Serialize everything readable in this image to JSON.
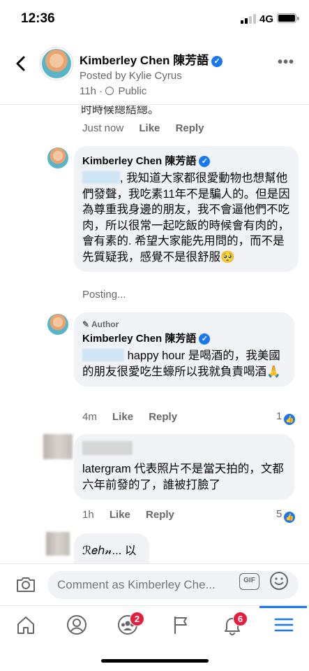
{
  "status_bar": {
    "time": "12:36",
    "network": "4G"
  },
  "post_header": {
    "name": "Kimberley Chen 陳芳語",
    "posted_by": "Posted by Kylie Cyrus",
    "time": "11h",
    "audience": "Public"
  },
  "thread": {
    "cut_text": "时時候總結總。",
    "top_actions": {
      "time": "Just now",
      "like": "Like",
      "reply": "Reply"
    },
    "comment1": {
      "name": "Kimberley Chen 陳芳語",
      "text": ", 我知道大家都很愛動物也想幫他們發聲，我吃素11年不是騙人的。但是因為尊重我身邊的朋友，我不會逼他們不吃肉，所以很常一起吃飯的時候會有肉的，會有素的. 希望大家能先用問的，而不是先質疑我，感覺不是很舒服🥺",
      "status": "Posting..."
    },
    "comment2": {
      "author_label": "Author",
      "name": "Kimberley Chen 陳芳語",
      "text": " happy hour 是喝酒的，我美國的朋友很愛吃生蠔所以我就負責喝酒🙏",
      "time": "4m",
      "like": "Like",
      "reply": "Reply",
      "reactions": "1"
    },
    "comment3": {
      "text": "latergram 代表照片不是當天拍的，文都六年前發的了，誰被打臉了",
      "time": "1h",
      "like": "Like",
      "reply": "Reply",
      "reactions": "5"
    },
    "comment4": {
      "text": "ℛ𝑒ℎ𝓃... 以"
    }
  },
  "comment_bar": {
    "placeholder": "Comment as Kimberley Che...",
    "gif_label": "GIF"
  },
  "bottom_nav": {
    "items": [
      {
        "icon": "home-icon"
      },
      {
        "icon": "profile-icon"
      },
      {
        "icon": "groups-icon",
        "badge": "2"
      },
      {
        "icon": "pages-flag-icon"
      },
      {
        "icon": "notifications-bell-icon",
        "badge": "6"
      },
      {
        "icon": "menu-icon"
      }
    ]
  },
  "colors": {
    "accent": "#1877f2",
    "badge": "#e41e3f",
    "bubble": "#f0f2f5",
    "secondary_text": "#65676b"
  }
}
